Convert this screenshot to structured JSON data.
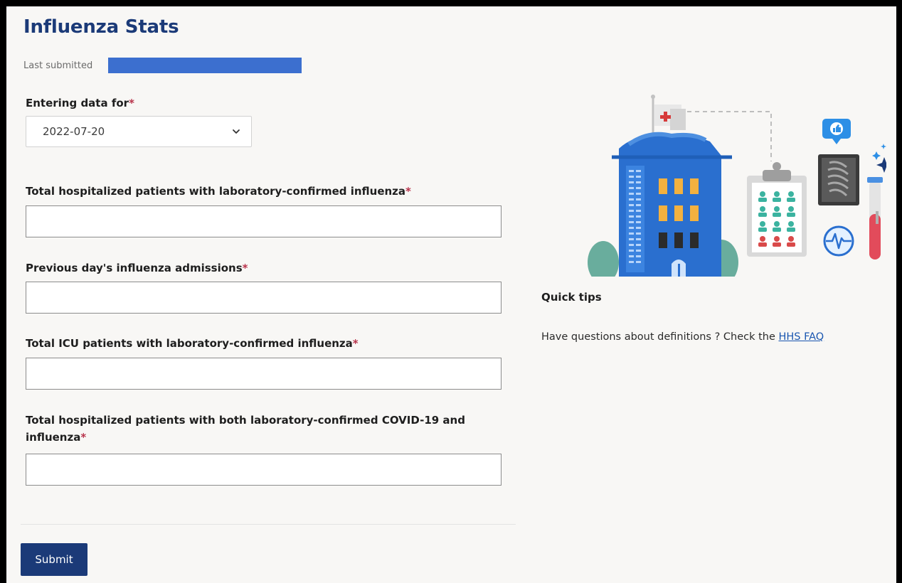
{
  "page": {
    "title": "Influenza Stats",
    "last_submitted_label": "Last submitted"
  },
  "form": {
    "entering_data_for": {
      "label": "Entering data for",
      "required_mark": "*",
      "selected_value": "2022-07-20"
    },
    "fields": [
      {
        "label": "Total hospitalized patients with laboratory-confirmed influenza",
        "required_mark": "*",
        "value": ""
      },
      {
        "label": "Previous day's influenza admissions",
        "required_mark": "*",
        "value": ""
      },
      {
        "label": "Total ICU patients with laboratory-confirmed influenza",
        "required_mark": "*",
        "value": ""
      },
      {
        "label_line1": "Total hospitalized patients with both laboratory-confirmed COVID-19 and",
        "label_line2": "influenza",
        "required_mark": "*",
        "value": ""
      }
    ],
    "submit_label": "Submit"
  },
  "tips": {
    "title": "Quick tips",
    "text": "Have questions about definitions ? Check the",
    "link_label": "HHS FAQ"
  },
  "colors": {
    "brand": "#1b3a78",
    "required": "#b8334b",
    "redaction": "#3c6fcf",
    "link": "#1a56b0"
  }
}
